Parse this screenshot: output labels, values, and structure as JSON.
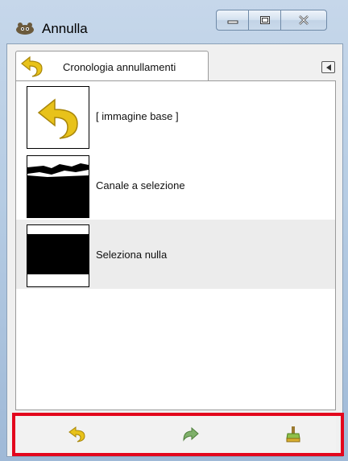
{
  "window": {
    "title": "Annulla"
  },
  "tab": {
    "label": "Cronologia annullamenti"
  },
  "history": [
    {
      "label": "[ immagine base ]",
      "thumb": "undo-arrow"
    },
    {
      "label": "Canale a selezione",
      "thumb": "channel-selection"
    },
    {
      "label": "Seleziona nulla",
      "thumb": "select-none"
    }
  ],
  "selected_index": 2,
  "colors": {
    "highlight_box": "#e3061d",
    "selected_row": "#ececec",
    "undo_yellow": "#e8c21a"
  }
}
